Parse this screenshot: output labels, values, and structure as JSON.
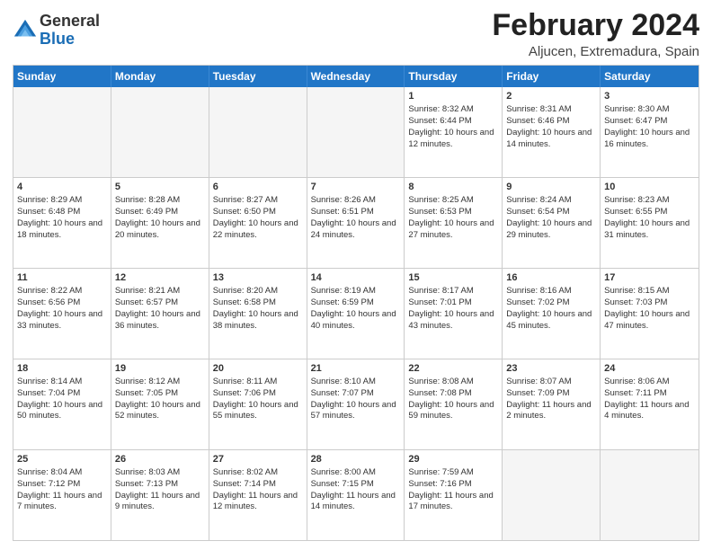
{
  "logo": {
    "general": "General",
    "blue": "Blue"
  },
  "title": "February 2024",
  "subtitle": "Aljucen, Extremadura, Spain",
  "headers": [
    "Sunday",
    "Monday",
    "Tuesday",
    "Wednesday",
    "Thursday",
    "Friday",
    "Saturday"
  ],
  "weeks": [
    [
      {
        "day": "",
        "info": ""
      },
      {
        "day": "",
        "info": ""
      },
      {
        "day": "",
        "info": ""
      },
      {
        "day": "",
        "info": ""
      },
      {
        "day": "1",
        "info": "Sunrise: 8:32 AM\nSunset: 6:44 PM\nDaylight: 10 hours and 12 minutes."
      },
      {
        "day": "2",
        "info": "Sunrise: 8:31 AM\nSunset: 6:46 PM\nDaylight: 10 hours and 14 minutes."
      },
      {
        "day": "3",
        "info": "Sunrise: 8:30 AM\nSunset: 6:47 PM\nDaylight: 10 hours and 16 minutes."
      }
    ],
    [
      {
        "day": "4",
        "info": "Sunrise: 8:29 AM\nSunset: 6:48 PM\nDaylight: 10 hours and 18 minutes."
      },
      {
        "day": "5",
        "info": "Sunrise: 8:28 AM\nSunset: 6:49 PM\nDaylight: 10 hours and 20 minutes."
      },
      {
        "day": "6",
        "info": "Sunrise: 8:27 AM\nSunset: 6:50 PM\nDaylight: 10 hours and 22 minutes."
      },
      {
        "day": "7",
        "info": "Sunrise: 8:26 AM\nSunset: 6:51 PM\nDaylight: 10 hours and 24 minutes."
      },
      {
        "day": "8",
        "info": "Sunrise: 8:25 AM\nSunset: 6:53 PM\nDaylight: 10 hours and 27 minutes."
      },
      {
        "day": "9",
        "info": "Sunrise: 8:24 AM\nSunset: 6:54 PM\nDaylight: 10 hours and 29 minutes."
      },
      {
        "day": "10",
        "info": "Sunrise: 8:23 AM\nSunset: 6:55 PM\nDaylight: 10 hours and 31 minutes."
      }
    ],
    [
      {
        "day": "11",
        "info": "Sunrise: 8:22 AM\nSunset: 6:56 PM\nDaylight: 10 hours and 33 minutes."
      },
      {
        "day": "12",
        "info": "Sunrise: 8:21 AM\nSunset: 6:57 PM\nDaylight: 10 hours and 36 minutes."
      },
      {
        "day": "13",
        "info": "Sunrise: 8:20 AM\nSunset: 6:58 PM\nDaylight: 10 hours and 38 minutes."
      },
      {
        "day": "14",
        "info": "Sunrise: 8:19 AM\nSunset: 6:59 PM\nDaylight: 10 hours and 40 minutes."
      },
      {
        "day": "15",
        "info": "Sunrise: 8:17 AM\nSunset: 7:01 PM\nDaylight: 10 hours and 43 minutes."
      },
      {
        "day": "16",
        "info": "Sunrise: 8:16 AM\nSunset: 7:02 PM\nDaylight: 10 hours and 45 minutes."
      },
      {
        "day": "17",
        "info": "Sunrise: 8:15 AM\nSunset: 7:03 PM\nDaylight: 10 hours and 47 minutes."
      }
    ],
    [
      {
        "day": "18",
        "info": "Sunrise: 8:14 AM\nSunset: 7:04 PM\nDaylight: 10 hours and 50 minutes."
      },
      {
        "day": "19",
        "info": "Sunrise: 8:12 AM\nSunset: 7:05 PM\nDaylight: 10 hours and 52 minutes."
      },
      {
        "day": "20",
        "info": "Sunrise: 8:11 AM\nSunset: 7:06 PM\nDaylight: 10 hours and 55 minutes."
      },
      {
        "day": "21",
        "info": "Sunrise: 8:10 AM\nSunset: 7:07 PM\nDaylight: 10 hours and 57 minutes."
      },
      {
        "day": "22",
        "info": "Sunrise: 8:08 AM\nSunset: 7:08 PM\nDaylight: 10 hours and 59 minutes."
      },
      {
        "day": "23",
        "info": "Sunrise: 8:07 AM\nSunset: 7:09 PM\nDaylight: 11 hours and 2 minutes."
      },
      {
        "day": "24",
        "info": "Sunrise: 8:06 AM\nSunset: 7:11 PM\nDaylight: 11 hours and 4 minutes."
      }
    ],
    [
      {
        "day": "25",
        "info": "Sunrise: 8:04 AM\nSunset: 7:12 PM\nDaylight: 11 hours and 7 minutes."
      },
      {
        "day": "26",
        "info": "Sunrise: 8:03 AM\nSunset: 7:13 PM\nDaylight: 11 hours and 9 minutes."
      },
      {
        "day": "27",
        "info": "Sunrise: 8:02 AM\nSunset: 7:14 PM\nDaylight: 11 hours and 12 minutes."
      },
      {
        "day": "28",
        "info": "Sunrise: 8:00 AM\nSunset: 7:15 PM\nDaylight: 11 hours and 14 minutes."
      },
      {
        "day": "29",
        "info": "Sunrise: 7:59 AM\nSunset: 7:16 PM\nDaylight: 11 hours and 17 minutes."
      },
      {
        "day": "",
        "info": ""
      },
      {
        "day": "",
        "info": ""
      }
    ]
  ]
}
